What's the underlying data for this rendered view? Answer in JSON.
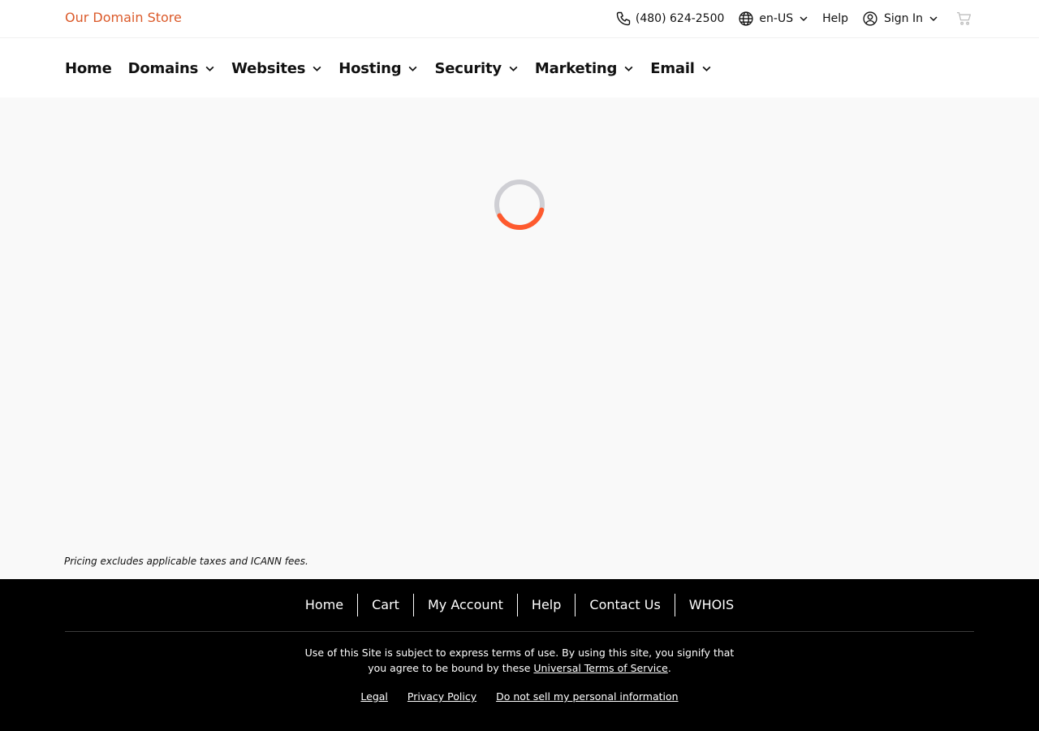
{
  "brand": {
    "name": "Our Domain Store",
    "color": "#db5a2a"
  },
  "utility": {
    "phone": "(480) 624-2500",
    "language": "en-US",
    "help": "Help",
    "sign_in": "Sign In",
    "icons": [
      "phone-icon",
      "globe-icon",
      "user-circle-icon",
      "cart-icon",
      "chevron-down-icon"
    ]
  },
  "nav": {
    "items": [
      {
        "label": "Home",
        "has_dropdown": false
      },
      {
        "label": "Domains",
        "has_dropdown": true
      },
      {
        "label": "Websites",
        "has_dropdown": true
      },
      {
        "label": "Hosting",
        "has_dropdown": true
      },
      {
        "label": "Security",
        "has_dropdown": true
      },
      {
        "label": "Marketing",
        "has_dropdown": true
      },
      {
        "label": "Email",
        "has_dropdown": true
      }
    ]
  },
  "content": {
    "loading": true,
    "spinner_color": "#fe5a2e",
    "spinner_track_color": "#cfcfd4",
    "disclaimer": "Pricing excludes applicable taxes and ICANN fees."
  },
  "footer": {
    "links": [
      "Home",
      "Cart",
      "My Account",
      "Help",
      "Contact Us",
      "WHOIS"
    ],
    "terms_before": "Use of this Site is subject to express terms of use. By using this site, you signify that you agree to be bound by these ",
    "terms_link": "Universal Terms of Service",
    "terms_after": ".",
    "legal_links": [
      "Legal",
      "Privacy Policy",
      "Do not sell my personal information"
    ]
  }
}
